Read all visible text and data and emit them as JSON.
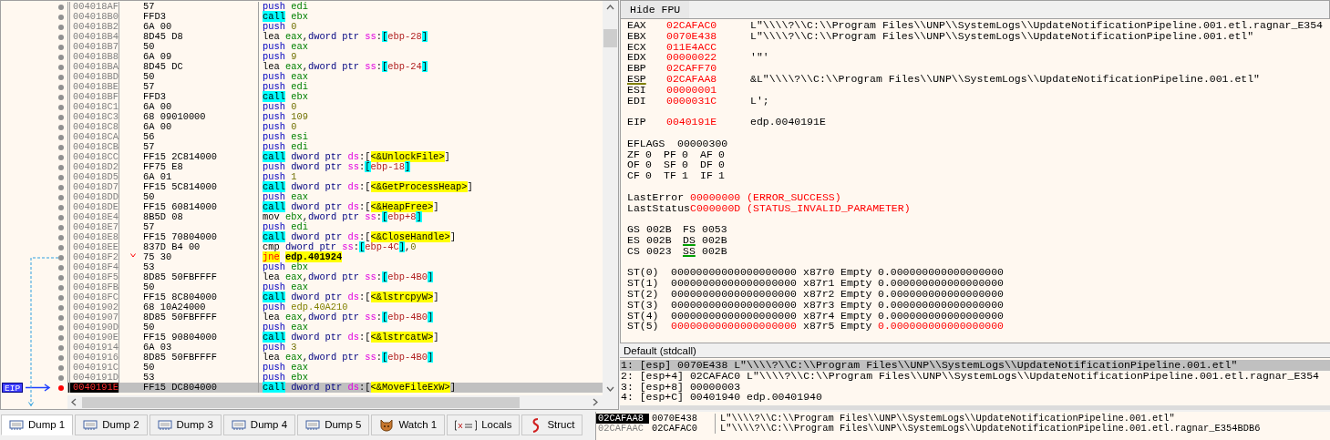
{
  "disassembly": {
    "rows": [
      {
        "address": "004018AF",
        "bytes": "57",
        "mnemonic": {
          "text": "push",
          "kind": "push"
        },
        "operands": [
          {
            "text": "edi",
            "kind": "reg"
          }
        ],
        "breakpoint": false,
        "current": false,
        "jump": false
      },
      {
        "address": "004018B0",
        "bytes": "FFD3",
        "mnemonic": {
          "text": "call",
          "kind": "call"
        },
        "operands": [
          {
            "text": "ebx",
            "kind": "reg"
          }
        ],
        "breakpoint": false,
        "current": false,
        "jump": false
      },
      {
        "address": "004018B2",
        "bytes": "6A 00",
        "mnemonic": {
          "text": "push",
          "kind": "push"
        },
        "operands": [
          {
            "text": "0",
            "kind": "num"
          }
        ],
        "breakpoint": false,
        "current": false,
        "jump": false
      },
      {
        "address": "004018B4",
        "bytes": "8D45 D8",
        "mnemonic": {
          "text": "lea",
          "kind": "plain"
        },
        "operands": [
          {
            "text": "eax",
            "kind": "reg"
          },
          {
            "text": ",",
            "kind": "punct"
          },
          {
            "text": "dword ptr ",
            "kind": "ptr"
          },
          {
            "text": "ss",
            "kind": "seg"
          },
          {
            "text": ":",
            "kind": "punct"
          },
          {
            "text": "[",
            "kind": "bracket"
          },
          {
            "text": "ebp-28",
            "kind": "mem"
          },
          {
            "text": "]",
            "kind": "bracket"
          }
        ],
        "breakpoint": false,
        "current": false,
        "jump": false
      },
      {
        "address": "004018B7",
        "bytes": "50",
        "mnemonic": {
          "text": "push",
          "kind": "push"
        },
        "operands": [
          {
            "text": "eax",
            "kind": "reg"
          }
        ],
        "breakpoint": false,
        "current": false,
        "jump": false
      },
      {
        "address": "004018B8",
        "bytes": "6A 09",
        "mnemonic": {
          "text": "push",
          "kind": "push"
        },
        "operands": [
          {
            "text": "9",
            "kind": "num"
          }
        ],
        "breakpoint": false,
        "current": false,
        "jump": false
      },
      {
        "address": "004018BA",
        "bytes": "8D45 DC",
        "mnemonic": {
          "text": "lea",
          "kind": "plain"
        },
        "operands": [
          {
            "text": "eax",
            "kind": "reg"
          },
          {
            "text": ",",
            "kind": "punct"
          },
          {
            "text": "dword ptr ",
            "kind": "ptr"
          },
          {
            "text": "ss",
            "kind": "seg"
          },
          {
            "text": ":",
            "kind": "punct"
          },
          {
            "text": "[",
            "kind": "bracket"
          },
          {
            "text": "ebp-24",
            "kind": "mem"
          },
          {
            "text": "]",
            "kind": "bracket"
          }
        ],
        "breakpoint": false,
        "current": false,
        "jump": false
      },
      {
        "address": "004018BD",
        "bytes": "50",
        "mnemonic": {
          "text": "push",
          "kind": "push"
        },
        "operands": [
          {
            "text": "eax",
            "kind": "reg"
          }
        ],
        "breakpoint": false,
        "current": false,
        "jump": false
      },
      {
        "address": "004018BE",
        "bytes": "57",
        "mnemonic": {
          "text": "push",
          "kind": "push"
        },
        "operands": [
          {
            "text": "edi",
            "kind": "reg"
          }
        ],
        "breakpoint": false,
        "current": false,
        "jump": false
      },
      {
        "address": "004018BF",
        "bytes": "FFD3",
        "mnemonic": {
          "text": "call",
          "kind": "call"
        },
        "operands": [
          {
            "text": "ebx",
            "kind": "reg"
          }
        ],
        "breakpoint": false,
        "current": false,
        "jump": false
      },
      {
        "address": "004018C1",
        "bytes": "6A 00",
        "mnemonic": {
          "text": "push",
          "kind": "push"
        },
        "operands": [
          {
            "text": "0",
            "kind": "num"
          }
        ],
        "breakpoint": false,
        "current": false,
        "jump": false
      },
      {
        "address": "004018C3",
        "bytes": "68 09010000",
        "mnemonic": {
          "text": "push",
          "kind": "push"
        },
        "operands": [
          {
            "text": "109",
            "kind": "num"
          }
        ],
        "breakpoint": false,
        "current": false,
        "jump": false
      },
      {
        "address": "004018C8",
        "bytes": "6A 00",
        "mnemonic": {
          "text": "push",
          "kind": "push"
        },
        "operands": [
          {
            "text": "0",
            "kind": "num"
          }
        ],
        "breakpoint": false,
        "current": false,
        "jump": false
      },
      {
        "address": "004018CA",
        "bytes": "56",
        "mnemonic": {
          "text": "push",
          "kind": "push"
        },
        "operands": [
          {
            "text": "esi",
            "kind": "reg"
          }
        ],
        "breakpoint": false,
        "current": false,
        "jump": false
      },
      {
        "address": "004018CB",
        "bytes": "57",
        "mnemonic": {
          "text": "push",
          "kind": "push"
        },
        "operands": [
          {
            "text": "edi",
            "kind": "reg"
          }
        ],
        "breakpoint": false,
        "current": false,
        "jump": false
      },
      {
        "address": "004018CC",
        "bytes": "FF15 2C814000",
        "mnemonic": {
          "text": "call",
          "kind": "call"
        },
        "operands": [
          {
            "text": "dword ptr ",
            "kind": "ptr"
          },
          {
            "text": "ds",
            "kind": "seg"
          },
          {
            "text": ":[",
            "kind": "punct"
          },
          {
            "text": "<&UnlockFile>",
            "kind": "api"
          },
          {
            "text": "]",
            "kind": "punct"
          }
        ],
        "breakpoint": false,
        "current": false,
        "jump": false
      },
      {
        "address": "004018D2",
        "bytes": "FF75 E8",
        "mnemonic": {
          "text": "push",
          "kind": "push"
        },
        "operands": [
          {
            "text": "dword ptr ",
            "kind": "ptr"
          },
          {
            "text": "ss",
            "kind": "seg"
          },
          {
            "text": ":",
            "kind": "punct"
          },
          {
            "text": "[",
            "kind": "bracket"
          },
          {
            "text": "ebp-18",
            "kind": "mem"
          },
          {
            "text": "]",
            "kind": "bracket"
          }
        ],
        "breakpoint": false,
        "current": false,
        "jump": false
      },
      {
        "address": "004018D5",
        "bytes": "6A 01",
        "mnemonic": {
          "text": "push",
          "kind": "push"
        },
        "operands": [
          {
            "text": "1",
            "kind": "num"
          }
        ],
        "breakpoint": false,
        "current": false,
        "jump": false
      },
      {
        "address": "004018D7",
        "bytes": "FF15 5C814000",
        "mnemonic": {
          "text": "call",
          "kind": "call"
        },
        "operands": [
          {
            "text": "dword ptr ",
            "kind": "ptr"
          },
          {
            "text": "ds",
            "kind": "seg"
          },
          {
            "text": ":[",
            "kind": "punct"
          },
          {
            "text": "<&GetProcessHeap>",
            "kind": "api"
          },
          {
            "text": "]",
            "kind": "punct"
          }
        ],
        "breakpoint": false,
        "current": false,
        "jump": false
      },
      {
        "address": "004018DD",
        "bytes": "50",
        "mnemonic": {
          "text": "push",
          "kind": "push"
        },
        "operands": [
          {
            "text": "eax",
            "kind": "reg"
          }
        ],
        "breakpoint": false,
        "current": false,
        "jump": false
      },
      {
        "address": "004018DE",
        "bytes": "FF15 60814000",
        "mnemonic": {
          "text": "call",
          "kind": "call"
        },
        "operands": [
          {
            "text": "dword ptr ",
            "kind": "ptr"
          },
          {
            "text": "ds",
            "kind": "seg"
          },
          {
            "text": ":[",
            "kind": "punct"
          },
          {
            "text": "<&HeapFree>",
            "kind": "api"
          },
          {
            "text": "]",
            "kind": "punct"
          }
        ],
        "breakpoint": false,
        "current": false,
        "jump": false
      },
      {
        "address": "004018E4",
        "bytes": "8B5D 08",
        "mnemonic": {
          "text": "mov",
          "kind": "plain"
        },
        "operands": [
          {
            "text": "ebx",
            "kind": "reg"
          },
          {
            "text": ",",
            "kind": "punct"
          },
          {
            "text": "dword ptr ",
            "kind": "ptr"
          },
          {
            "text": "ss",
            "kind": "seg"
          },
          {
            "text": ":",
            "kind": "punct"
          },
          {
            "text": "[",
            "kind": "bracket"
          },
          {
            "text": "ebp+8",
            "kind": "mem"
          },
          {
            "text": "]",
            "kind": "bracket"
          }
        ],
        "breakpoint": false,
        "current": false,
        "jump": false
      },
      {
        "address": "004018E7",
        "bytes": "57",
        "mnemonic": {
          "text": "push",
          "kind": "push"
        },
        "operands": [
          {
            "text": "edi",
            "kind": "reg"
          }
        ],
        "breakpoint": false,
        "current": false,
        "jump": false
      },
      {
        "address": "004018E8",
        "bytes": "FF15 70804000",
        "mnemonic": {
          "text": "call",
          "kind": "call"
        },
        "operands": [
          {
            "text": "dword ptr ",
            "kind": "ptr"
          },
          {
            "text": "ds",
            "kind": "seg"
          },
          {
            "text": ":[",
            "kind": "punct"
          },
          {
            "text": "<&CloseHandle>",
            "kind": "api"
          },
          {
            "text": "]",
            "kind": "punct"
          }
        ],
        "breakpoint": false,
        "current": false,
        "jump": false
      },
      {
        "address": "004018EE",
        "bytes": "837D B4 00",
        "mnemonic": {
          "text": "cmp",
          "kind": "plain"
        },
        "operands": [
          {
            "text": "dword ptr ",
            "kind": "ptr"
          },
          {
            "text": "ss",
            "kind": "seg"
          },
          {
            "text": ":",
            "kind": "punct"
          },
          {
            "text": "[",
            "kind": "bracket"
          },
          {
            "text": "ebp-4C",
            "kind": "mem"
          },
          {
            "text": "]",
            "kind": "bracket"
          },
          {
            "text": ",",
            "kind": "punct"
          },
          {
            "text": "0",
            "kind": "num"
          }
        ],
        "breakpoint": false,
        "current": false,
        "jump": false
      },
      {
        "address": "004018F2",
        "bytes": "75 30",
        "mnemonic": {
          "text": "jne",
          "kind": "jump"
        },
        "operands": [
          {
            "text": "edp.401924",
            "kind": "target"
          }
        ],
        "breakpoint": false,
        "current": false,
        "jump": true
      },
      {
        "address": "004018F4",
        "bytes": "53",
        "mnemonic": {
          "text": "push",
          "kind": "push"
        },
        "operands": [
          {
            "text": "ebx",
            "kind": "reg"
          }
        ],
        "breakpoint": false,
        "current": false,
        "jump": false
      },
      {
        "address": "004018F5",
        "bytes": "8D85 50FBFFFF",
        "mnemonic": {
          "text": "lea",
          "kind": "plain"
        },
        "operands": [
          {
            "text": "eax",
            "kind": "reg"
          },
          {
            "text": ",",
            "kind": "punct"
          },
          {
            "text": "dword ptr ",
            "kind": "ptr"
          },
          {
            "text": "ss",
            "kind": "seg"
          },
          {
            "text": ":",
            "kind": "punct"
          },
          {
            "text": "[",
            "kind": "bracket"
          },
          {
            "text": "ebp-4B0",
            "kind": "mem"
          },
          {
            "text": "]",
            "kind": "bracket"
          }
        ],
        "breakpoint": false,
        "current": false,
        "jump": false
      },
      {
        "address": "004018FB",
        "bytes": "50",
        "mnemonic": {
          "text": "push",
          "kind": "push"
        },
        "operands": [
          {
            "text": "eax",
            "kind": "reg"
          }
        ],
        "breakpoint": false,
        "current": false,
        "jump": false
      },
      {
        "address": "004018FC",
        "bytes": "FF15 8C804000",
        "mnemonic": {
          "text": "call",
          "kind": "call"
        },
        "operands": [
          {
            "text": "dword ptr ",
            "kind": "ptr"
          },
          {
            "text": "ds",
            "kind": "seg"
          },
          {
            "text": ":[",
            "kind": "punct"
          },
          {
            "text": "<&lstrcpyW>",
            "kind": "api"
          },
          {
            "text": "]",
            "kind": "punct"
          }
        ],
        "breakpoint": false,
        "current": false,
        "jump": false
      },
      {
        "address": "00401902",
        "bytes": "68 10A24000",
        "mnemonic": {
          "text": "push",
          "kind": "push"
        },
        "operands": [
          {
            "text": "edp.40A210",
            "kind": "addr"
          }
        ],
        "breakpoint": false,
        "current": false,
        "jump": false
      },
      {
        "address": "00401907",
        "bytes": "8D85 50FBFFFF",
        "mnemonic": {
          "text": "lea",
          "kind": "plain"
        },
        "operands": [
          {
            "text": "eax",
            "kind": "reg"
          },
          {
            "text": ",",
            "kind": "punct"
          },
          {
            "text": "dword ptr ",
            "kind": "ptr"
          },
          {
            "text": "ss",
            "kind": "seg"
          },
          {
            "text": ":",
            "kind": "punct"
          },
          {
            "text": "[",
            "kind": "bracket"
          },
          {
            "text": "ebp-4B0",
            "kind": "mem"
          },
          {
            "text": "]",
            "kind": "bracket"
          }
        ],
        "breakpoint": false,
        "current": false,
        "jump": false
      },
      {
        "address": "0040190D",
        "bytes": "50",
        "mnemonic": {
          "text": "push",
          "kind": "push"
        },
        "operands": [
          {
            "text": "eax",
            "kind": "reg"
          }
        ],
        "breakpoint": false,
        "current": false,
        "jump": false
      },
      {
        "address": "0040190E",
        "bytes": "FF15 90804000",
        "mnemonic": {
          "text": "call",
          "kind": "call"
        },
        "operands": [
          {
            "text": "dword ptr ",
            "kind": "ptr"
          },
          {
            "text": "ds",
            "kind": "seg"
          },
          {
            "text": ":[",
            "kind": "punct"
          },
          {
            "text": "<&lstrcatW>",
            "kind": "api"
          },
          {
            "text": "]",
            "kind": "punct"
          }
        ],
        "breakpoint": false,
        "current": false,
        "jump": false
      },
      {
        "address": "00401914",
        "bytes": "6A 03",
        "mnemonic": {
          "text": "push",
          "kind": "push"
        },
        "operands": [
          {
            "text": "3",
            "kind": "num"
          }
        ],
        "breakpoint": false,
        "current": false,
        "jump": false
      },
      {
        "address": "00401916",
        "bytes": "8D85 50FBFFFF",
        "mnemonic": {
          "text": "lea",
          "kind": "plain"
        },
        "operands": [
          {
            "text": "eax",
            "kind": "reg"
          },
          {
            "text": ",",
            "kind": "punct"
          },
          {
            "text": "dword ptr ",
            "kind": "ptr"
          },
          {
            "text": "ss",
            "kind": "seg"
          },
          {
            "text": ":",
            "kind": "punct"
          },
          {
            "text": "[",
            "kind": "bracket"
          },
          {
            "text": "ebp-4B0",
            "kind": "mem"
          },
          {
            "text": "]",
            "kind": "bracket"
          }
        ],
        "breakpoint": false,
        "current": false,
        "jump": false
      },
      {
        "address": "0040191C",
        "bytes": "50",
        "mnemonic": {
          "text": "push",
          "kind": "push"
        },
        "operands": [
          {
            "text": "eax",
            "kind": "reg"
          }
        ],
        "breakpoint": false,
        "current": false,
        "jump": false
      },
      {
        "address": "0040191D",
        "bytes": "53",
        "mnemonic": {
          "text": "push",
          "kind": "push"
        },
        "operands": [
          {
            "text": "ebx",
            "kind": "reg"
          }
        ],
        "breakpoint": false,
        "current": false,
        "jump": false
      },
      {
        "address": "0040191E",
        "bytes": "FF15 DC804000",
        "mnemonic": {
          "text": "call",
          "kind": "call"
        },
        "operands": [
          {
            "text": "dword ptr ",
            "kind": "ptr"
          },
          {
            "text": "ds",
            "kind": "seg"
          },
          {
            "text": ":[",
            "kind": "punct"
          },
          {
            "text": "<&MoveFileExW>",
            "kind": "api"
          },
          {
            "text": "]",
            "kind": "punct"
          }
        ],
        "breakpoint": true,
        "current": true,
        "jump": false
      }
    ],
    "eip_label": "EIP"
  },
  "registers": {
    "toggle_button": "Hide FPU",
    "general": [
      {
        "name": "EAX",
        "value": "02CAFAC0",
        "comment": "L\"\\\\\\\\?\\\\C:\\\\Program Files\\\\UNP\\\\SystemLogs\\\\UpdateNotificationPipeline.001.etl.ragnar_E354",
        "underlined": false
      },
      {
        "name": "EBX",
        "value": "0070E438",
        "comment": "L\"\\\\\\\\?\\\\C:\\\\Program Files\\\\UNP\\\\SystemLogs\\\\UpdateNotificationPipeline.001.etl\"",
        "underlined": false
      },
      {
        "name": "ECX",
        "value": "011E4ACC",
        "underlined": false
      },
      {
        "name": "EDX",
        "value": "00000022",
        "comment": "'\"'",
        "underlined": false
      },
      {
        "name": "EBP",
        "value": "02CAFF70",
        "underlined": false
      },
      {
        "name": "ESP",
        "value": "02CAFAA8",
        "comment": "&L\"\\\\\\\\?\\\\C:\\\\Program Files\\\\UNP\\\\SystemLogs\\\\UpdateNotificationPipeline.001.etl\"",
        "underlined": true
      },
      {
        "name": "ESI",
        "value": "00000001",
        "underlined": false
      },
      {
        "name": "EDI",
        "value": "0000031C",
        "comment": "L';",
        "underlined": false
      }
    ],
    "eip": {
      "name": "EIP",
      "value": "0040191E",
      "comment": "edp.0040191E"
    },
    "eflags": {
      "name": "EFLAGS",
      "value": "00000300"
    },
    "flags": [
      [
        {
          "name": "ZF",
          "value": "0"
        },
        {
          "name": "PF",
          "value": "0"
        },
        {
          "name": "AF",
          "value": "0"
        }
      ],
      [
        {
          "name": "OF",
          "value": "0"
        },
        {
          "name": "SF",
          "value": "0"
        },
        {
          "name": "DF",
          "value": "0"
        }
      ],
      [
        {
          "name": "CF",
          "value": "0"
        },
        {
          "name": "TF",
          "value": "1"
        },
        {
          "name": "IF",
          "value": "1"
        }
      ]
    ],
    "errors": [
      {
        "name": "LastError",
        "value": "00000000 (ERROR_SUCCESS)"
      },
      {
        "name": "LastStatus",
        "value": "C000000D (STATUS_INVALID_PARAMETER)"
      }
    ],
    "segments": [
      [
        {
          "name": "GS",
          "value": "002B",
          "underlined": false
        },
        {
          "name": "FS",
          "value": "0053",
          "underlined": false
        }
      ],
      [
        {
          "name": "ES",
          "value": "002B",
          "underlined": false
        },
        {
          "name": "DS",
          "value": "002B",
          "underlined": true
        }
      ],
      [
        {
          "name": "CS",
          "value": "0023",
          "underlined": false
        },
        {
          "name": "SS",
          "value": "002B",
          "underlined": true
        }
      ]
    ],
    "fpu": [
      {
        "name": "ST(0)",
        "raw": "00000000000000000000",
        "tag": "x87r0",
        "state": "Empty",
        "value": "0.000000000000000000",
        "changed": false
      },
      {
        "name": "ST(1)",
        "raw": "00000000000000000000",
        "tag": "x87r1",
        "state": "Empty",
        "value": "0.000000000000000000",
        "changed": false
      },
      {
        "name": "ST(2)",
        "raw": "00000000000000000000",
        "tag": "x87r2",
        "state": "Empty",
        "value": "0.000000000000000000",
        "changed": false
      },
      {
        "name": "ST(3)",
        "raw": "00000000000000000000",
        "tag": "x87r3",
        "state": "Empty",
        "value": "0.000000000000000000",
        "changed": false
      },
      {
        "name": "ST(4)",
        "raw": "00000000000000000000",
        "tag": "x87r4",
        "state": "Empty",
        "value": "0.000000000000000000",
        "changed": false
      },
      {
        "name": "ST(5)",
        "raw": "00000000000000000000",
        "tag": "x87r5",
        "state": "Empty",
        "value": "0.000000000000000000",
        "changed": true
      }
    ]
  },
  "call_arguments": {
    "header": "Default (stdcall)",
    "rows": [
      {
        "text": "1: [esp] 0070E438 L\"\\\\\\\\?\\\\C:\\\\Program Files\\\\UNP\\\\SystemLogs\\\\UpdateNotificationPipeline.001.etl\"",
        "selected": true
      },
      {
        "text": "2: [esp+4] 02CAFAC0 L\"\\\\\\\\?\\\\C:\\\\Program Files\\\\UNP\\\\SystemLogs\\\\UpdateNotificationPipeline.001.etl.ragnar_E354",
        "selected": false
      },
      {
        "text": "3: [esp+8] 00000003",
        "selected": false
      },
      {
        "text": "4: [esp+C] 00401940 edp.00401940",
        "selected": false
      }
    ]
  },
  "tabs": [
    {
      "label": "Dump 1",
      "kind": "dump",
      "selected": true
    },
    {
      "label": "Dump 2",
      "kind": "dump",
      "selected": false
    },
    {
      "label": "Dump 3",
      "kind": "dump",
      "selected": false
    },
    {
      "label": "Dump 4",
      "kind": "dump",
      "selected": false
    },
    {
      "label": "Dump 5",
      "kind": "dump",
      "selected": false
    },
    {
      "label": "Watch 1",
      "kind": "watch",
      "selected": false
    },
    {
      "label": "Locals",
      "kind": "locals",
      "selected": false
    },
    {
      "label": "Struct",
      "kind": "struct",
      "selected": false
    }
  ],
  "stack": [
    {
      "address": "02CAFAA8",
      "value": "0070E438",
      "comment": "L\"\\\\\\\\?\\\\C:\\\\Program Files\\\\UNP\\\\SystemLogs\\\\UpdateNotificationPipeline.001.etl\"",
      "selected": true
    },
    {
      "address": "02CAFAAC",
      "value": "02CAFAC0",
      "comment": "L\"\\\\\\\\?\\\\C:\\\\Program Files\\\\UNP\\\\SystemLogs\\\\UpdateNotificationPipeline.001.etl.ragnar_E354BDB6",
      "selected": false
    }
  ]
}
